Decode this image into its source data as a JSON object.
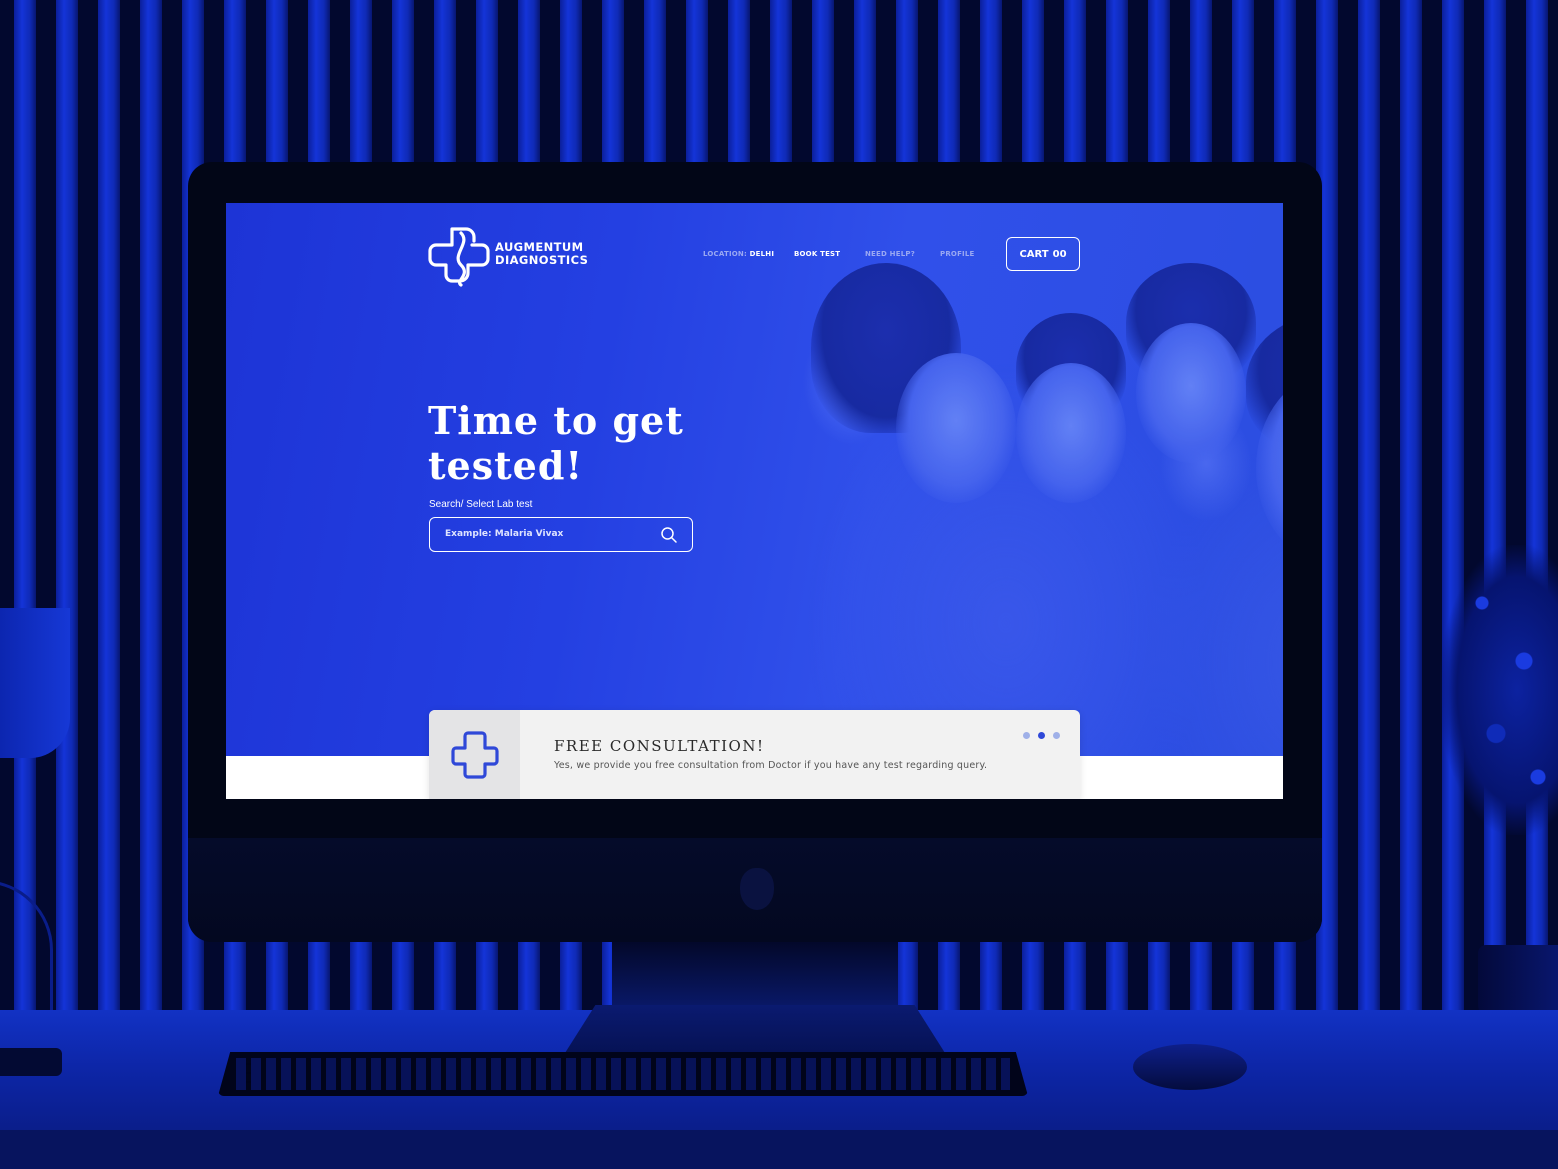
{
  "brand": {
    "line1": "AUGMENTUM",
    "line2": "DIAGNOSTICS"
  },
  "nav": {
    "location_label": "LOCATION:",
    "location_value": "DELHI",
    "book_test": "BOOK TEST",
    "need_help": "NEED HELP?",
    "profile": "PROFILE",
    "cart_label": "CART",
    "cart_count": "00"
  },
  "hero": {
    "headline_line1": "Time to get",
    "headline_line2": "tested!",
    "search_label": "Search/ Select Lab test",
    "search_placeholder": "Example: Malaria Vivax"
  },
  "consultation": {
    "title": "FREE CONSULTATION!",
    "description": "Yes, we provide you free consultation from Doctor if you have any test regarding query.",
    "active_slide": 2,
    "slide_count": 3
  },
  "colors": {
    "brand_blue": "#2440e2",
    "accent_blue": "#2f48d8",
    "card_bg": "#f2f2f2"
  }
}
